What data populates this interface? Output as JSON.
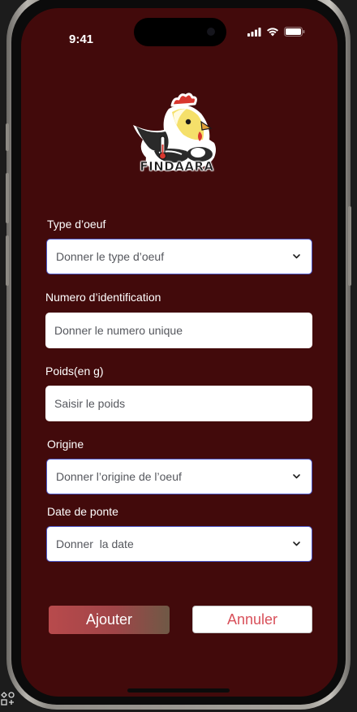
{
  "status_bar": {
    "time": "9:41"
  },
  "app": {
    "logo_text": "FINDAARA"
  },
  "form": {
    "egg_type": {
      "label": "Type d’oeuf",
      "placeholder": "Donner le type d’oeuf"
    },
    "id_number": {
      "label": "Numero d’identification",
      "placeholder": "Donner le numero unique"
    },
    "weight": {
      "label": "Poids(en g)",
      "placeholder": "Saisir le poids"
    },
    "origin": {
      "label": "Origine",
      "placeholder": "Donner l’origine de l’oeuf"
    },
    "lay_date": {
      "label": "Date de ponte",
      "placeholder": "Donner  la date"
    }
  },
  "actions": {
    "add_label": "Ajouter",
    "cancel_label": "Annuler"
  },
  "colors": {
    "screen_bg": "#420a0b",
    "select_border": "#4a56c7",
    "add_button": "#b84a4c",
    "cancel_text": "#d8505a"
  },
  "icons": {
    "signal": "cellular-signal-icon",
    "wifi": "wifi-icon",
    "battery": "battery-icon",
    "dropdown": "chevron-down-icon"
  }
}
